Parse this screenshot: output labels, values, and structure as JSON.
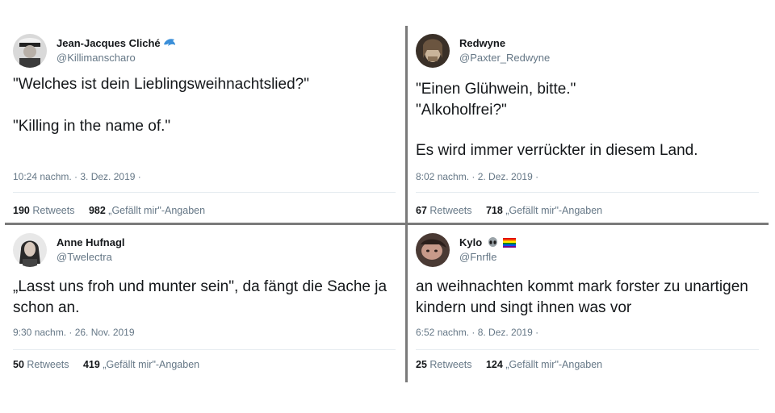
{
  "tweets": [
    {
      "name": "Jean-Jacques Cliché",
      "name_emoji": "dolphin-icon",
      "handle": "@Killimanscharo",
      "lines": [
        "\"Welches ist dein Lieblingsweihnachtslied?\"",
        "",
        "\"Killing in the name of.\""
      ],
      "timestamp": "10:24 nachm. · 3. Dez. 2019 ·",
      "retweets": "190",
      "retweets_label": "Retweets",
      "likes": "982",
      "likes_label": "„Gefällt mir\"-Angaben"
    },
    {
      "name": "Redwyne",
      "handle": "@Paxter_Redwyne",
      "lines": [
        "\"Einen Glühwein, bitte.\"",
        "\"Alkoholfrei?\"",
        "",
        "Es wird immer verrückter in diesem Land."
      ],
      "timestamp": "8:02 nachm. · 2. Dez. 2019 ·",
      "retweets": "67",
      "retweets_label": "Retweets",
      "likes": "718",
      "likes_label": "„Gefällt mir\"-Angaben"
    },
    {
      "name": "Anne Hufnagl",
      "handle": "@Twelectra",
      "lines": [
        "„Lasst uns froh und munter sein\", da fängt die Sache ja schon an."
      ],
      "timestamp": "9:30 nachm. · 26. Nov. 2019",
      "retweets": "50",
      "retweets_label": "Retweets",
      "likes": "419",
      "likes_label": "„Gefällt mir\"-Angaben"
    },
    {
      "name": "Kylo",
      "name_emoji": "alien-and-rainbow-flag-icons",
      "handle": "@Fnrfle",
      "lines": [
        "an weihnachten kommt mark forster zu unartigen kindern und singt ihnen was vor"
      ],
      "timestamp": "6:52 nachm. · 8. Dez. 2019 ·",
      "retweets": "25",
      "retweets_label": "Retweets",
      "likes": "124",
      "likes_label": "„Gefällt mir\"-Angaben"
    }
  ]
}
